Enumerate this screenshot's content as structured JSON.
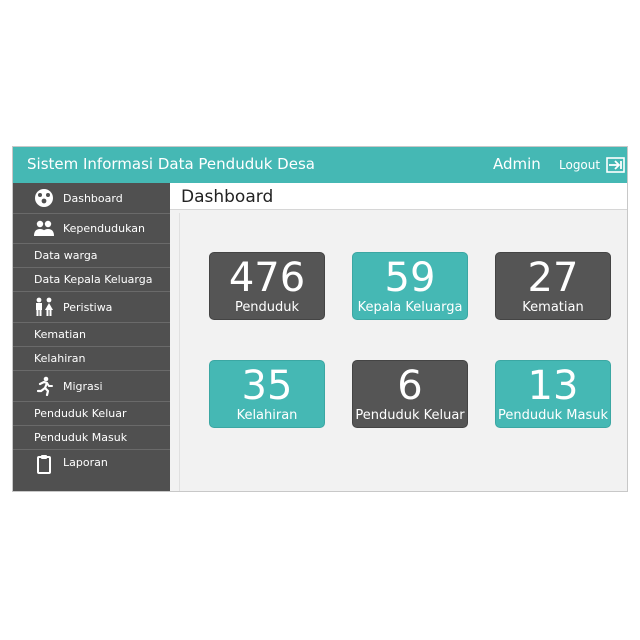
{
  "header": {
    "app_title": "Sistem Informasi Data Penduduk Desa",
    "user": "Admin",
    "logout_label": "Logout"
  },
  "sidebar": {
    "items": [
      {
        "label": "Dashboard",
        "icon": "dashboard-icon"
      },
      {
        "label": "Kependudukan",
        "icon": "people-icon"
      },
      {
        "label": "Data warga"
      },
      {
        "label": "Data Kepala Keluarga"
      },
      {
        "label": "Peristiwa",
        "icon": "couple-icon"
      },
      {
        "label": "Kematian"
      },
      {
        "label": "Kelahiran"
      },
      {
        "label": "Migrasi",
        "icon": "running-person-icon"
      },
      {
        "label": "Penduduk Keluar"
      },
      {
        "label": "Penduduk Masuk"
      },
      {
        "label": "Laporan",
        "icon": "clipboard-icon"
      }
    ]
  },
  "main": {
    "title": "Dashboard",
    "tiles": [
      {
        "value": "476",
        "label": "Penduduk",
        "style": "dark"
      },
      {
        "value": "59",
        "label": "Kepala Keluarga",
        "style": "teal"
      },
      {
        "value": "27",
        "label": "Kematian",
        "style": "dark"
      },
      {
        "value": "35",
        "label": "Kelahiran",
        "style": "teal"
      },
      {
        "value": "6",
        "label": "Penduduk Keluar",
        "style": "dark"
      },
      {
        "value": "13",
        "label": "Penduduk Masuk",
        "style": "teal"
      }
    ]
  },
  "colors": {
    "accent": "#45b8b4",
    "sidebar": "#505050",
    "tile_dark": "#555555"
  }
}
